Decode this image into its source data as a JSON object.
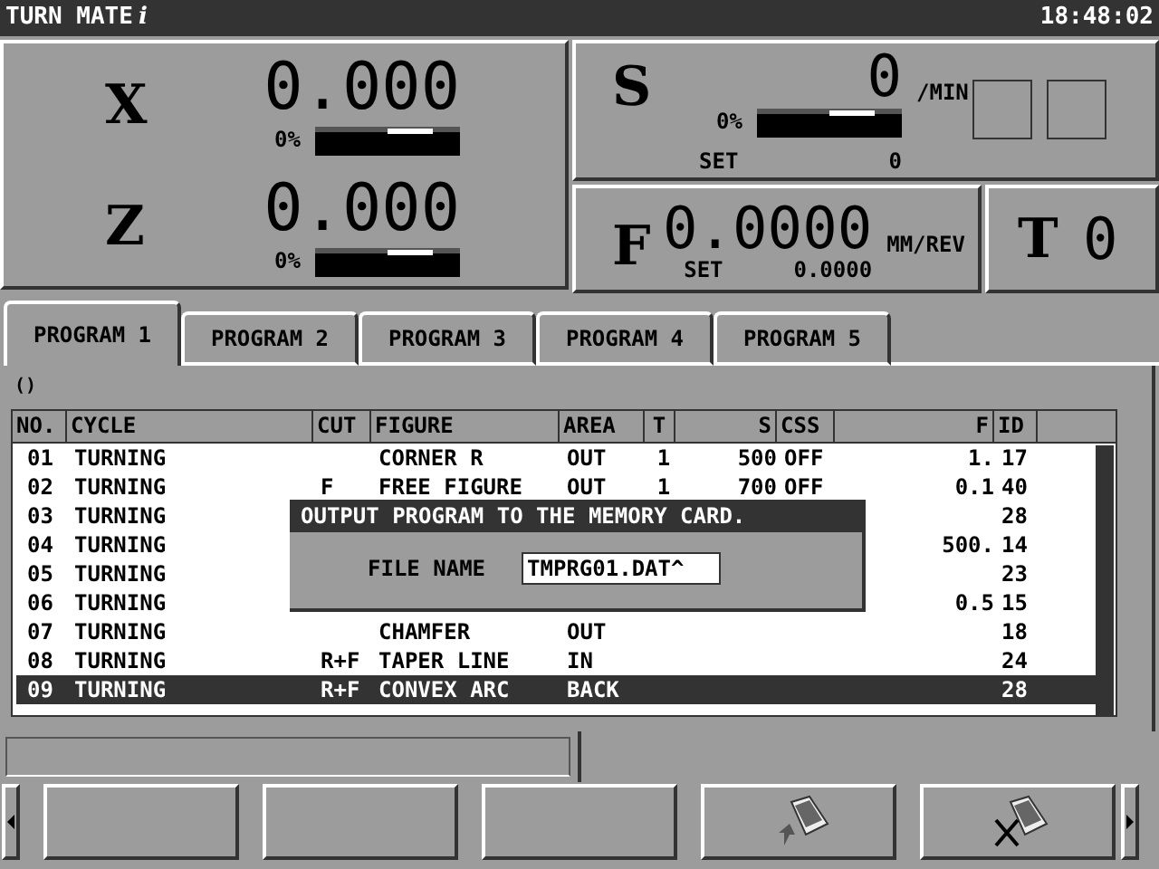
{
  "title_bar": {
    "title": "TURN MATE",
    "title_mark": "i",
    "clock": "18:48:02"
  },
  "axes": [
    {
      "label": "X",
      "value": "0.000",
      "percent": "0%"
    },
    {
      "label": "Z",
      "value": "0.000",
      "percent": "0%"
    }
  ],
  "spindle": {
    "label": "S",
    "value": "0",
    "unit": "/MIN",
    "percent": "0%",
    "set_label": "SET",
    "set_value": "0"
  },
  "feed": {
    "label": "F",
    "value": "0.0000",
    "unit": "MM/REV",
    "set_label": "SET",
    "set_value": "0.0000"
  },
  "tool": {
    "label": "T",
    "value": "0"
  },
  "tabs": [
    {
      "label": "PROGRAM 1",
      "selected": true
    },
    {
      "label": "PROGRAM 2",
      "selected": false
    },
    {
      "label": "PROGRAM 3",
      "selected": false
    },
    {
      "label": "PROGRAM 4",
      "selected": false
    },
    {
      "label": "PROGRAM 5",
      "selected": false
    }
  ],
  "program_name": "()",
  "table": {
    "columns": [
      "NO.",
      "CYCLE",
      "CUT",
      "FIGURE",
      "AREA",
      "T",
      "S",
      "CSS",
      "F",
      "ID"
    ],
    "rows": [
      {
        "cells": [
          "01",
          "TURNING",
          "",
          "CORNER R",
          "OUT",
          "1",
          "500",
          "OFF",
          "1.",
          "17"
        ],
        "selected": false
      },
      {
        "cells": [
          "02",
          "TURNING",
          "F",
          "FREE FIGURE",
          "OUT",
          "1",
          "700",
          "OFF",
          "0.1",
          "40"
        ],
        "selected": false
      },
      {
        "cells": [
          "03",
          "TURNING",
          "",
          "",
          "",
          "",
          "",
          "",
          "",
          "28"
        ],
        "selected": false
      },
      {
        "cells": [
          "04",
          "TURNING",
          "",
          "",
          "",
          "",
          "",
          "",
          "500.",
          "14"
        ],
        "selected": false
      },
      {
        "cells": [
          "05",
          "TURNING",
          "",
          "",
          "",
          "",
          "",
          "",
          "",
          "23"
        ],
        "selected": false
      },
      {
        "cells": [
          "06",
          "TURNING",
          "",
          "",
          "",
          "",
          "",
          "",
          "0.5",
          "15"
        ],
        "selected": false
      },
      {
        "cells": [
          "07",
          "TURNING",
          "",
          "CHAMFER",
          "OUT",
          "",
          "",
          "",
          "",
          "18"
        ],
        "selected": false
      },
      {
        "cells": [
          "08",
          "TURNING",
          "R+F",
          "TAPER LINE",
          "IN",
          "",
          "",
          "",
          "",
          "24"
        ],
        "selected": false
      },
      {
        "cells": [
          "09",
          "TURNING",
          "R+F",
          "CONVEX ARC",
          "BACK",
          "",
          "",
          "",
          "",
          "28"
        ],
        "selected": true
      }
    ]
  },
  "dialog": {
    "title": "OUTPUT PROGRAM TO THE MEMORY CARD.",
    "field_label": "FILE NAME",
    "field_value": "TMPRG01.DAT^"
  },
  "softkeys": [
    {
      "kind": "blank"
    },
    {
      "kind": "blank"
    },
    {
      "kind": "blank"
    },
    {
      "kind": "card-arrow"
    },
    {
      "kind": "card-cross"
    }
  ]
}
